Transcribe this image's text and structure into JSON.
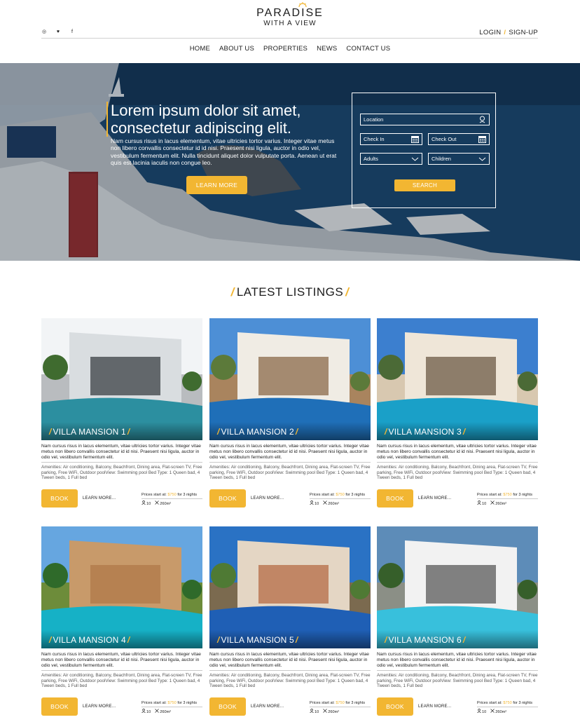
{
  "brand": {
    "name_top": "PARADISE",
    "name_bottom": "WITH A VIEW"
  },
  "social": [
    {
      "icon": "instagram-icon",
      "glyph": "◎"
    },
    {
      "icon": "twitter-icon",
      "glyph": "♥"
    },
    {
      "icon": "facebook-icon",
      "glyph": "f"
    }
  ],
  "auth": {
    "login": "LOGIN",
    "separator": "/",
    "signup": "SIGN-UP"
  },
  "nav": [
    "HOME",
    "ABOUT US",
    "PROPERTIES",
    "NEWS",
    "CONTACT US"
  ],
  "hero": {
    "title_line1": "Lorem ipsum dolor sit amet,",
    "title_line2": "consectetur adipiscing elit.",
    "body": "Nam cursus risus in lacus elementum, vitae ultricies tortor varius. Integer vitae metus non libero convallis consectetur id id nisi. Praesent nisi ligula, auctor in odio vel, vestibulum fermentum elit. Nulla tincidunt aliquet dolor vulputate porta. Aenean ut erat quis est lacinia iaculis non congue leo.",
    "cta": "LEARN MORE"
  },
  "search": {
    "location": "Location",
    "check_in": "Check In",
    "check_out": "Check Out",
    "adults": "Adults",
    "children": "Children",
    "submit": "SEARCH"
  },
  "listings_title": "LATEST LISTINGS",
  "listings": [
    {
      "name": "VILLA MANSION 1",
      "desc": "Nam cursus risus in lacus elementum, vitae ultricies tortor varius. Integer vitae metus non libero convallis consectetur id id nisi. Praesent nisi ligula, auctor in odio vel, vestibulum fermentum elit.",
      "amenities": "Amenities: Air conditioning, Balcony, Beachfront, Dining area, Flat-screen TV, Free parking, Free WiFi, Outdoor poolView: Swimming pool Bed Type: 1 Queen bad, 4 Tween beds, 1 Full bed",
      "book": "BOOK",
      "more": "LEARN MORE...",
      "price_prefix": "Prices start at:",
      "price": "$750",
      "price_suffix": "for 3 nights",
      "guests": "10",
      "area": "260m²"
    },
    {
      "name": "VILLA MANSION 2",
      "desc": "Nam cursus risus in lacus elementum, vitae ultricies tortor varius. Integer vitae metus non libero convallis consectetur id id nisi. Praesent nisi ligula, auctor in odio vel, vestibulum fermentum elit.",
      "amenities": "Amenities: Air conditioning, Balcony, Beachfront, Dining area, Flat-screen TV, Free parking, Free WiFi, Outdoor poolView: Swimming pool Bed Type: 1 Queen bad, 4 Tween beds, 1 Full bed",
      "book": "BOOK",
      "more": "LEARN MORE...",
      "price_prefix": "Prices start at:",
      "price": "$750",
      "price_suffix": "for 3 nights",
      "guests": "10",
      "area": "260m²"
    },
    {
      "name": "VILLA MANSION 3",
      "desc": "Nam cursus risus in lacus elementum, vitae ultricies tortor varius. Integer vitae metus non libero convallis consectetur id id nisi. Praesent nisi ligula, auctor in odio vel, vestibulum fermentum elit.",
      "amenities": "Amenities: Air conditioning, Balcony, Beachfront, Dining area, Flat-screen TV, Free parking, Free WiFi, Outdoor poolView: Swimming pool Bed Type: 1 Queen bad, 4 Tween beds, 1 Full bed",
      "book": "BOOK",
      "more": "LEARN MORE...",
      "price_prefix": "Prices start at:",
      "price": "$750",
      "price_suffix": "for 3 nights",
      "guests": "10",
      "area": "260m²"
    },
    {
      "name": "VILLA MANSION 4",
      "desc": "Nam cursus risus in lacus elementum, vitae ultricies tortor varius. Integer vitae metus non libero convallis consectetur id id nisi. Praesent nisi ligula, auctor in odio vel, vestibulum fermentum elit.",
      "amenities": "Amenities: Air conditioning, Balcony, Beachfront, Dining area, Flat-screen TV, Free parking, Free WiFi, Outdoor poolView: Swimming pool Bed Type: 1 Queen bad, 4 Tween beds, 1 Full bed",
      "book": "BOOK",
      "more": "LEARN MORE...",
      "price_prefix": "Prices start at:",
      "price": "$750",
      "price_suffix": "for 3 nights",
      "guests": "10",
      "area": "260m²"
    },
    {
      "name": "VILLA MANSION 5",
      "desc": "Nam cursus risus in lacus elementum, vitae ultricies tortor varius. Integer vitae metus non libero convallis consectetur id id nisi. Praesent nisi ligula, auctor in odio vel, vestibulum fermentum elit.",
      "amenities": "Amenities: Air conditioning, Balcony, Beachfront, Dining area, Flat-screen TV, Free parking, Free WiFi, Outdoor poolView: Swimming pool Bed Type: 1 Queen bad, 4 Tween beds, 1 Full bed",
      "book": "BOOK",
      "more": "LEARN MORE...",
      "price_prefix": "Prices start at:",
      "price": "$750",
      "price_suffix": "for 3 nights",
      "guests": "10",
      "area": "260m²"
    },
    {
      "name": "VILLA MANSION 6",
      "desc": "Nam cursus risus in lacus elementum, vitae ultricies tortor varius. Integer vitae metus non libero convallis consectetur id id nisi. Praesent nisi ligula, auctor in odio vel, vestibulum fermentum elit.",
      "amenities": "Amenities: Air conditioning, Balcony, Beachfront, Dining area, Flat-screen TV, Free parking, Free WiFi, Outdoor poolView: Swimming pool Bed Type: 1 Queen bad, 4 Tween beds, 1 Full bed",
      "book": "BOOK",
      "more": "LEARN MORE...",
      "price_prefix": "Prices start at:",
      "price": "$750",
      "price_suffix": "for 3 nights",
      "guests": "10",
      "area": "260m²"
    }
  ],
  "colors": {
    "accent": "#f2b632",
    "text": "#1c1c1c",
    "muted": "#555555",
    "rule": "#c9c9c9"
  }
}
